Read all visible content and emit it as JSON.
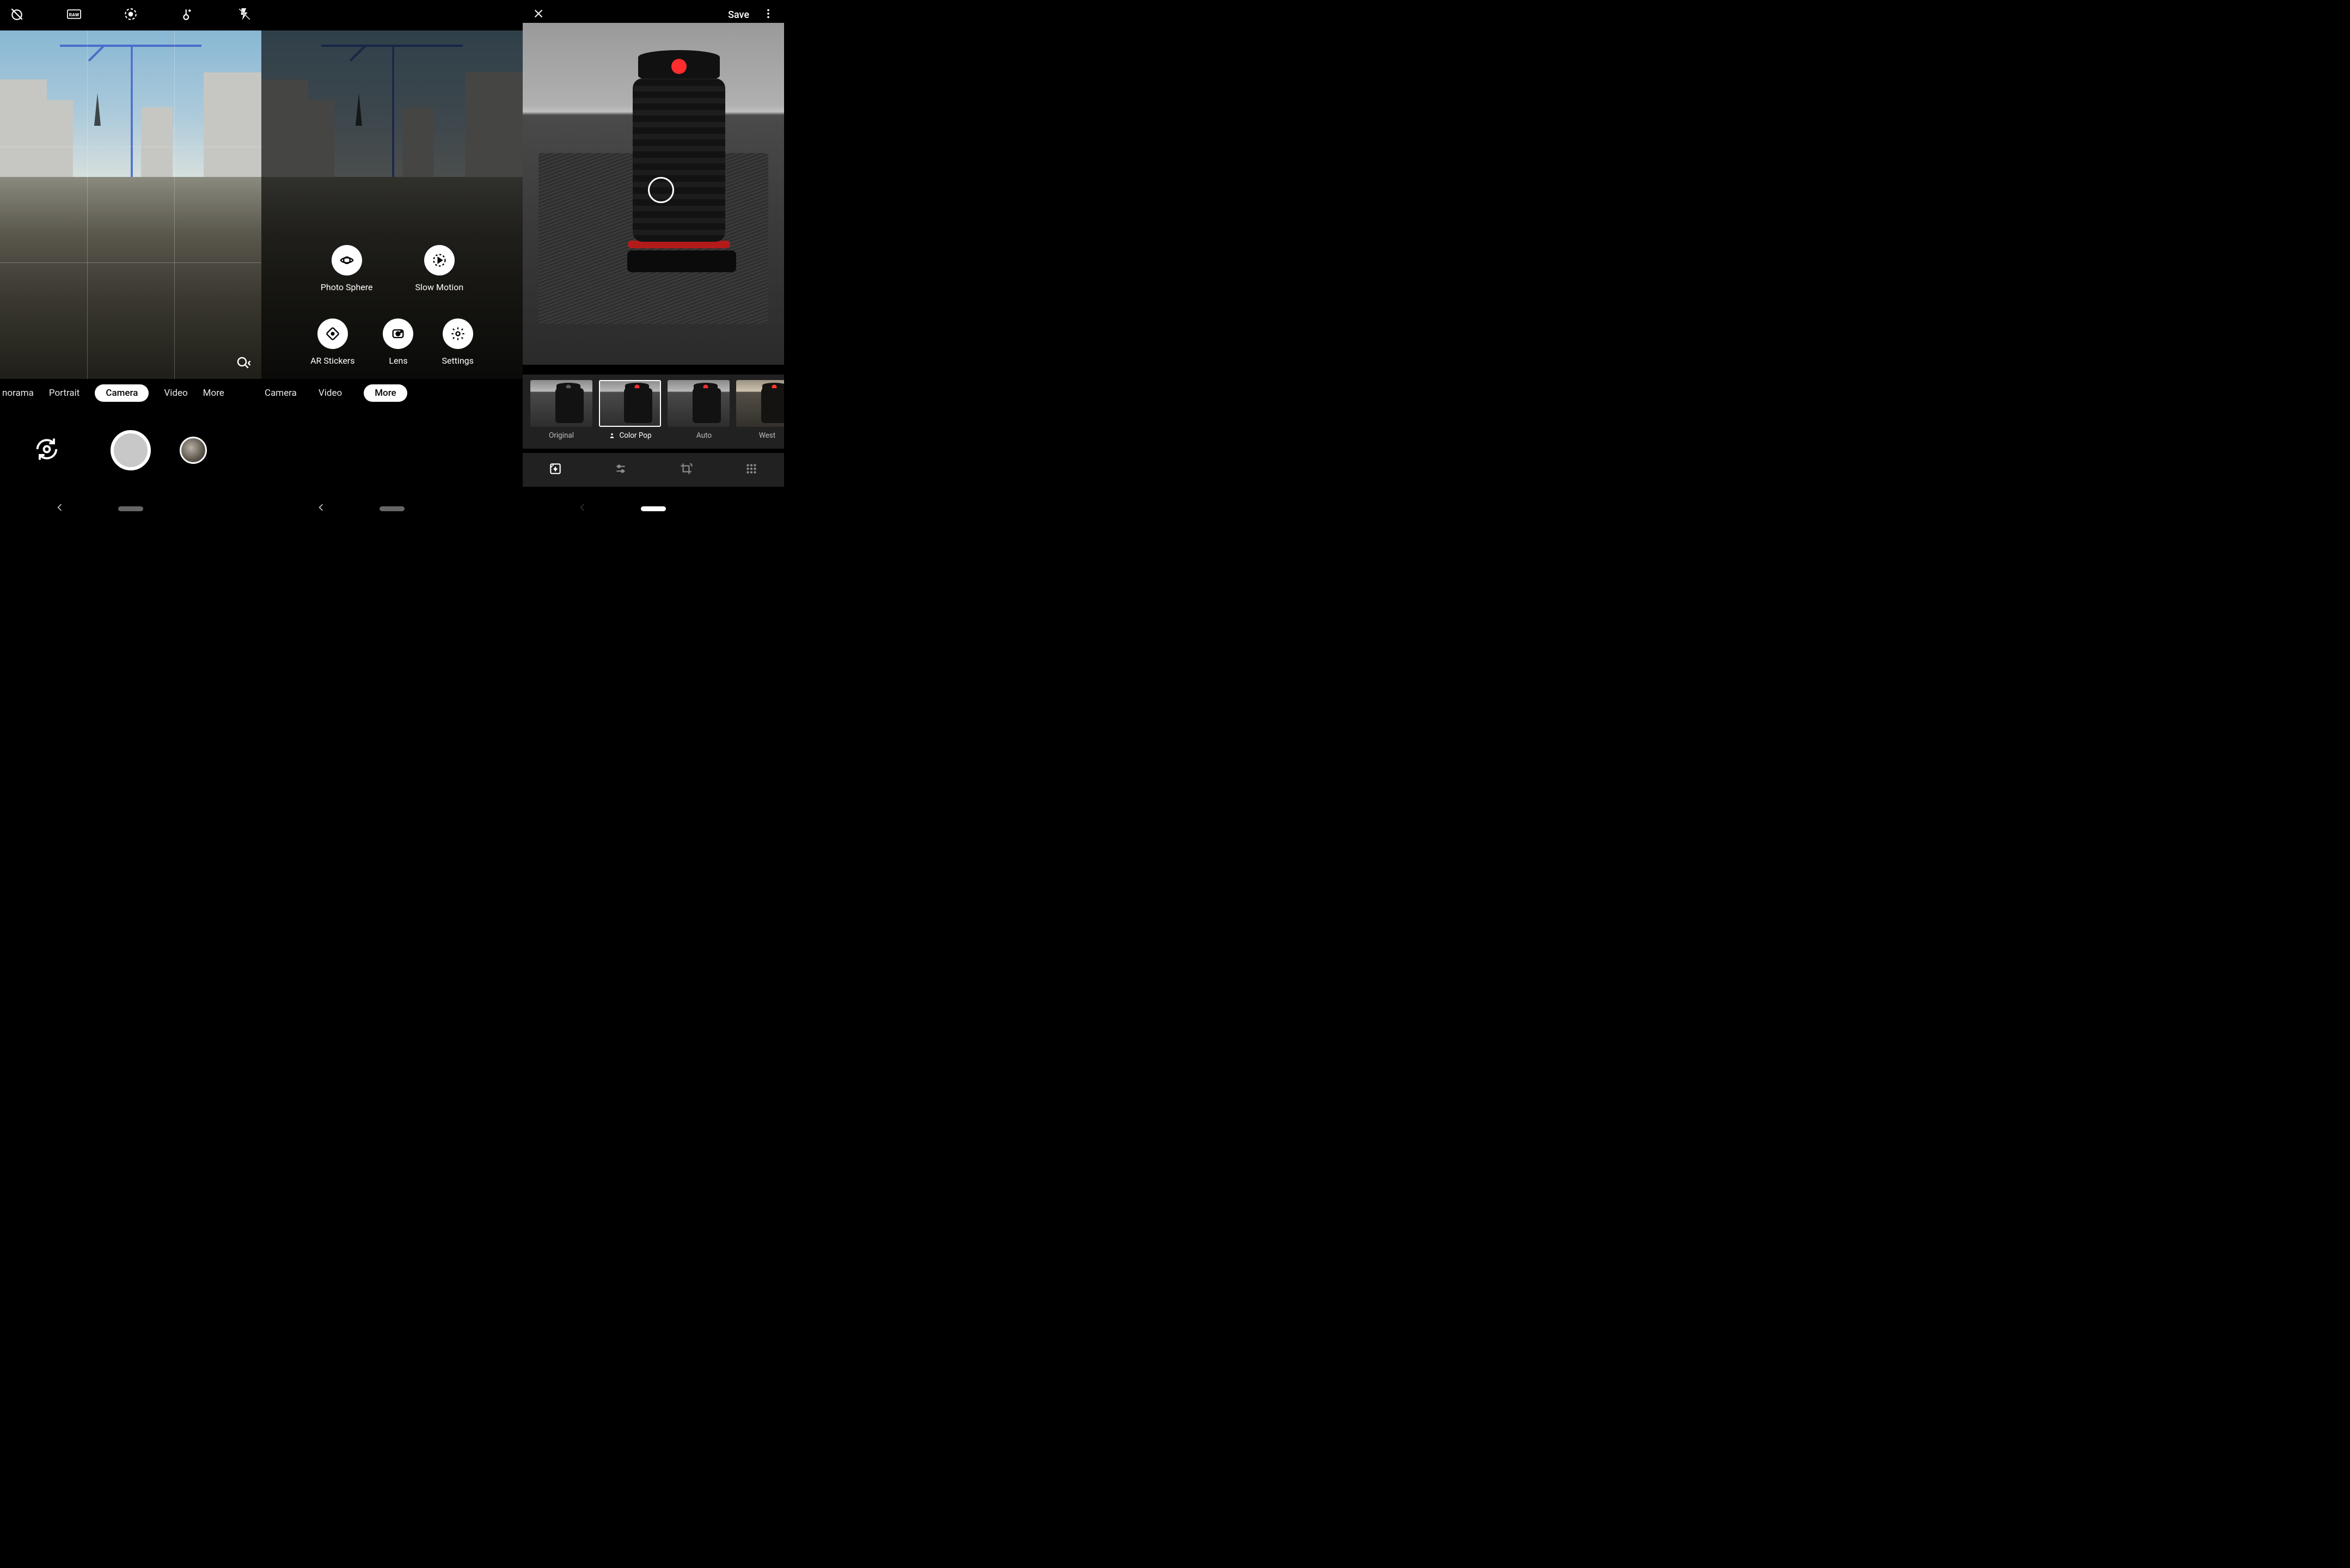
{
  "left": {
    "icons": [
      "timer-off-icon",
      "raw-icon",
      "motion-photo-icon",
      "white-balance-icon",
      "flash-off-icon"
    ],
    "raw_label": "RAW",
    "zoom_icon": "magnify-icon",
    "modes": [
      {
        "label": "norama",
        "active": false
      },
      {
        "label": "Portrait",
        "active": false
      },
      {
        "label": "Camera",
        "active": true
      },
      {
        "label": "Video",
        "active": false
      },
      {
        "label": "More",
        "active": false
      }
    ]
  },
  "mid": {
    "more_items": [
      {
        "label": "Photo Sphere",
        "icon": "photo-sphere-icon"
      },
      {
        "label": "Slow Motion",
        "icon": "slow-motion-icon"
      },
      {
        "label": "AR Stickers",
        "icon": "ar-stickers-icon"
      },
      {
        "label": "Lens",
        "icon": "lens-icon"
      },
      {
        "label": "Settings",
        "icon": "settings-icon"
      }
    ],
    "modes": [
      {
        "label": "Camera",
        "active": false
      },
      {
        "label": "Video",
        "active": false
      },
      {
        "label": "More",
        "active": true
      }
    ]
  },
  "right": {
    "save_label": "Save",
    "filters": [
      {
        "label": "Original",
        "icon": null,
        "selected": false,
        "style": "gray"
      },
      {
        "label": "Color Pop",
        "icon": "person-icon",
        "selected": true,
        "style": "color"
      },
      {
        "label": "Auto",
        "icon": "sparkle-icon",
        "selected": false,
        "style": "color"
      },
      {
        "label": "West",
        "icon": null,
        "selected": false,
        "style": "color"
      }
    ],
    "tools": [
      "photo-filter-icon",
      "sliders-icon",
      "crop-rotate-icon",
      "grid-icon"
    ]
  }
}
